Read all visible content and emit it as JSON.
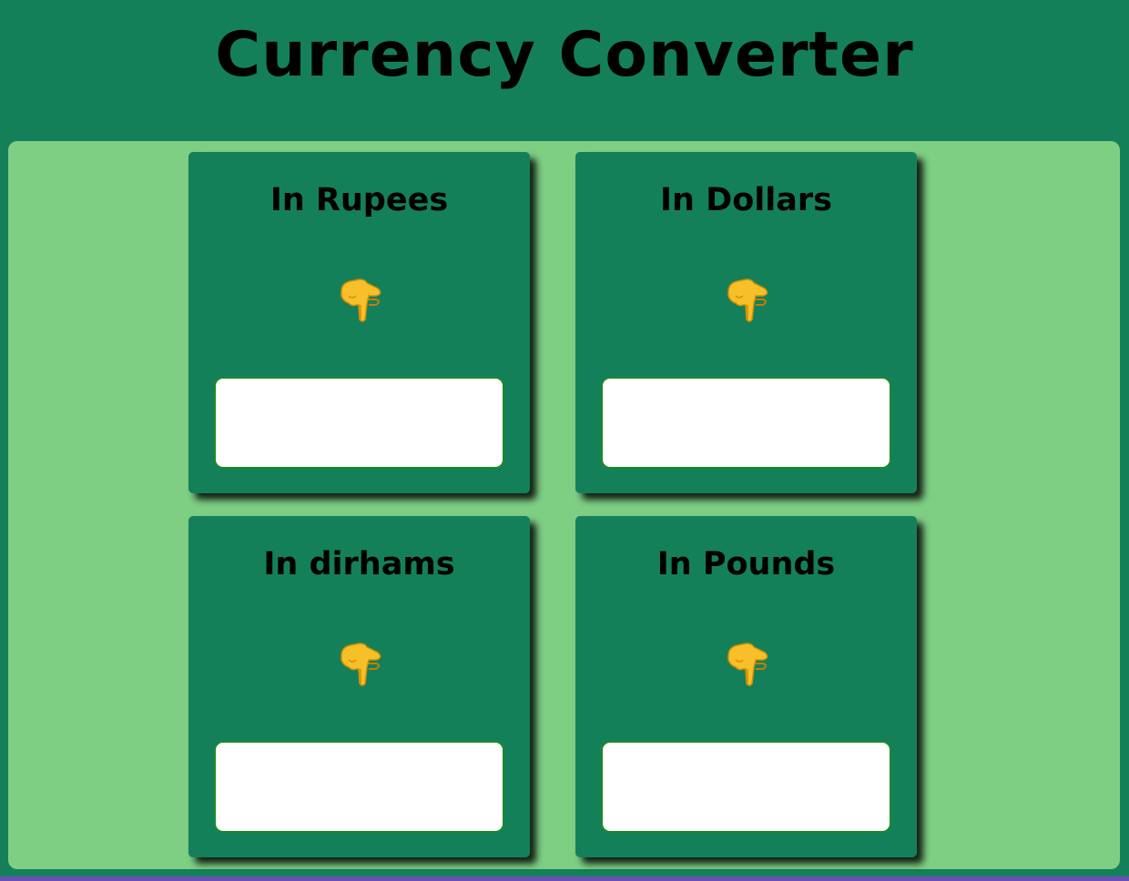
{
  "header": {
    "title": "Currency Converter"
  },
  "cards": [
    {
      "title": "In Rupees",
      "icon": "pointing-hand-icon",
      "input_value": "",
      "input_placeholder": ""
    },
    {
      "title": "In Dollars",
      "icon": "pointing-hand-icon",
      "input_value": "",
      "input_placeholder": ""
    },
    {
      "title": "In dirhams",
      "icon": "pointing-hand-icon",
      "input_value": "",
      "input_placeholder": ""
    },
    {
      "title": "In Pounds",
      "icon": "pointing-hand-icon",
      "input_value": "",
      "input_placeholder": ""
    }
  ],
  "colors": {
    "background": "#14805a",
    "panel": "#7ecf84",
    "card": "#14805a",
    "input_border": "#1c8a24",
    "bottom_strip": "#6a4fb5"
  }
}
